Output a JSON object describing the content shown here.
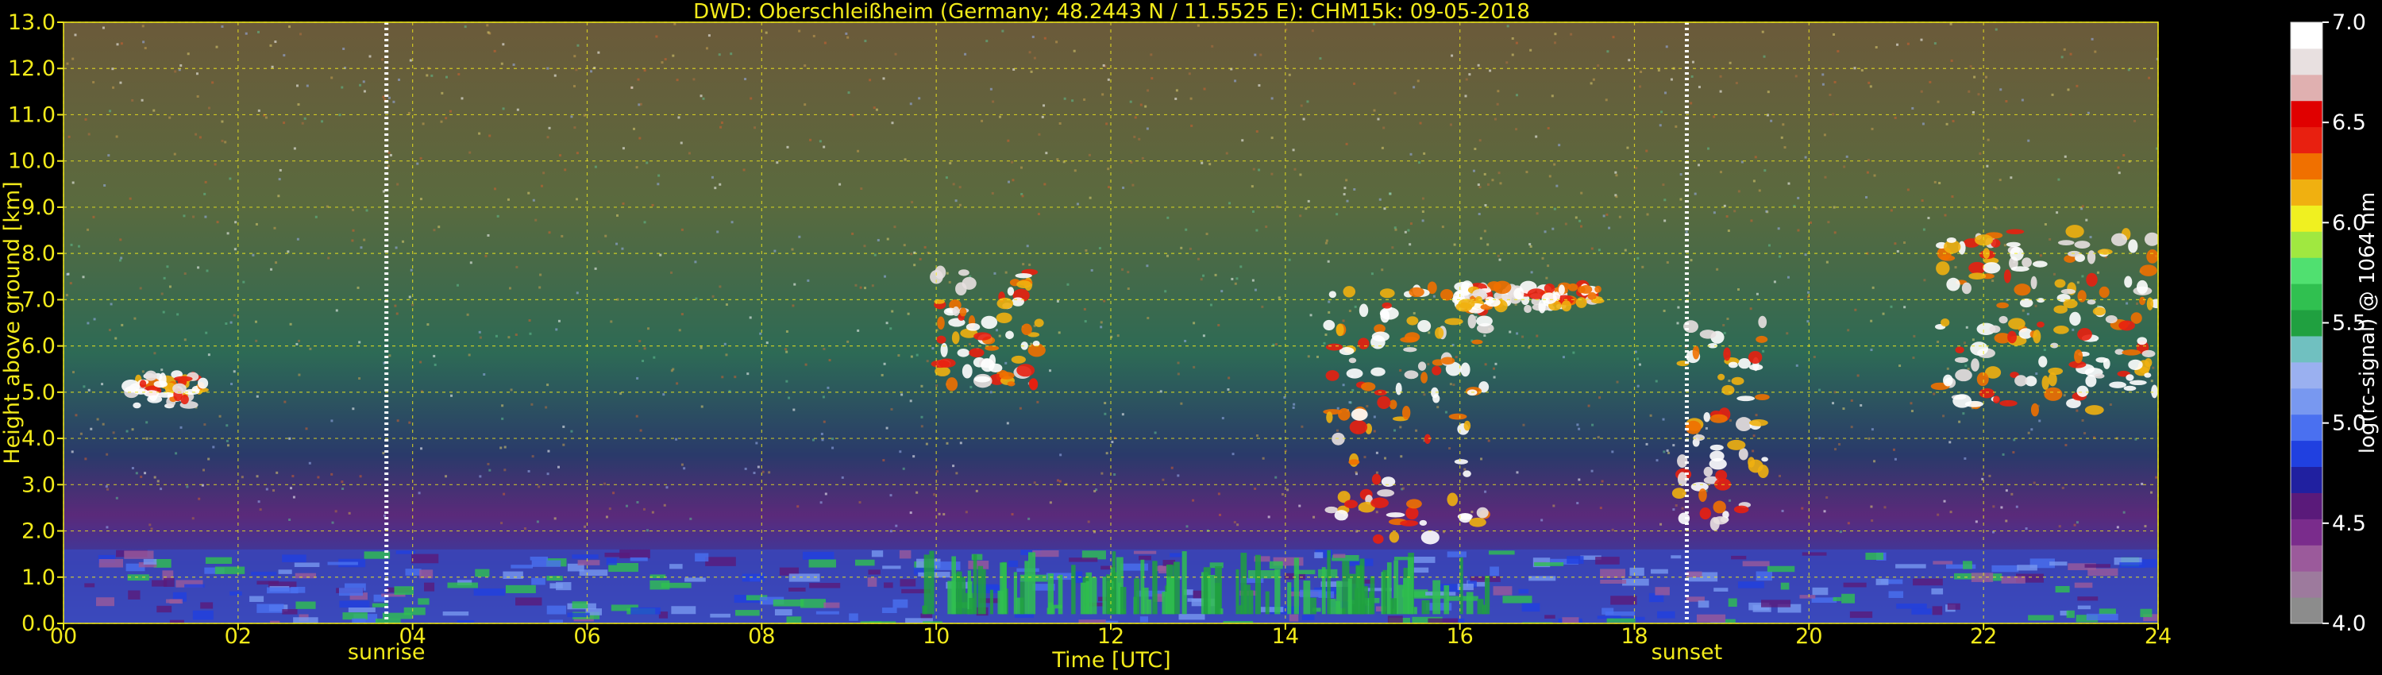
{
  "chart_data": {
    "type": "heatmap",
    "title": "DWD: Oberschleißheim (Germany; 48.2443 N / 11.5525 E):    CHM15k: 09-05-2018",
    "xlabel": "Time [UTC]",
    "ylabel": "Height above ground [km]",
    "xlim": [
      0,
      24
    ],
    "ylim": [
      0,
      13
    ],
    "x_ticks": [
      "00",
      "02",
      "04",
      "06",
      "08",
      "10",
      "12",
      "14",
      "16",
      "18",
      "20",
      "22",
      "24"
    ],
    "y_ticks": [
      "0.0",
      "1.0",
      "2.0",
      "3.0",
      "4.0",
      "5.0",
      "6.0",
      "7.0",
      "8.0",
      "9.0",
      "10.0",
      "11.0",
      "12.0",
      "13.0"
    ],
    "grid": true,
    "markers": [
      {
        "label": "sunrise",
        "time": 3.7
      },
      {
        "label": "sunset",
        "time": 18.6
      }
    ],
    "colorbar": {
      "label": "log(rc-signal) @ 1064 nm",
      "range": [
        4.0,
        7.0
      ],
      "ticks": [
        "4.0",
        "4.5",
        "5.0",
        "5.5",
        "6.0",
        "6.5",
        "7.0"
      ],
      "colors": [
        "#8c8c8c",
        "#9d7a9d",
        "#9b5a9b",
        "#7a2c8c",
        "#5a1a7a",
        "#2020a0",
        "#2040e0",
        "#4a70f0",
        "#7898f0",
        "#9ab0f0",
        "#70c0c0",
        "#20a040",
        "#30c050",
        "#50e070",
        "#a0e840",
        "#f0f020",
        "#f0b010",
        "#f07000",
        "#e82010",
        "#e00000",
        "#e0b0b0",
        "#e8e0e0",
        "#ffffff"
      ]
    },
    "features": [
      {
        "name": "boundary-layer",
        "t0": 0,
        "t1": 24,
        "h0": 0.0,
        "h1": 1.6
      },
      {
        "name": "cloud-morning",
        "t0": 0.75,
        "t1": 1.6,
        "h0": 4.7,
        "h1": 5.4
      },
      {
        "name": "cloud-noon",
        "t0": 10.0,
        "t1": 11.2,
        "h0": 5.1,
        "h1": 7.6
      },
      {
        "name": "cloud-afternoon",
        "t0": 14.5,
        "t1": 16.3,
        "h0": 1.8,
        "h1": 7.3
      },
      {
        "name": "cloud-midaltitude",
        "t0": 16.0,
        "t1": 17.6,
        "h0": 6.8,
        "h1": 7.3
      },
      {
        "name": "cloud-evening",
        "t0": 18.5,
        "t1": 19.5,
        "h0": 2.1,
        "h1": 6.6
      },
      {
        "name": "cloud-night",
        "t0": 21.5,
        "t1": 24.0,
        "h0": 4.5,
        "h1": 8.5
      }
    ]
  }
}
